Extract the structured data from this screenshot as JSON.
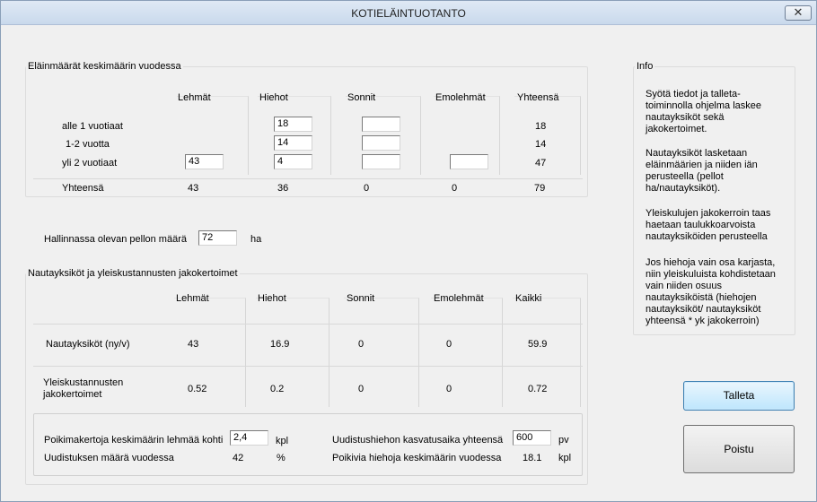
{
  "window": {
    "title": "KOTIELÄINTUOTANTO",
    "close_symbol": "✕"
  },
  "animals": {
    "legend": "Eläinmäärät keskimäärin vuodessa",
    "columns": [
      "Lehmät",
      "Hiehot",
      "Sonnit",
      "Emolehmät",
      "Yhteensä"
    ],
    "rows": [
      {
        "label": "alle 1 vuotiaat",
        "hiehot": "18",
        "sonnit": "",
        "total": "18"
      },
      {
        "label": "1-2 vuotta",
        "hiehot": "14",
        "sonnit": "",
        "total": "14"
      },
      {
        "label": "yli 2 vuotiaat",
        "lehmat": "43",
        "hiehot": "4",
        "sonnit": "",
        "emolehmat": "",
        "total": "47"
      }
    ],
    "totals": {
      "label": "Yhteensä",
      "lehmat": "43",
      "hiehot": "36",
      "sonnit": "0",
      "emolehmat": "0",
      "total": "79"
    }
  },
  "field": {
    "label": "Hallinnassa olevan pellon määrä",
    "value": "72",
    "unit": "ha"
  },
  "units": {
    "legend": "Nautayksiköt ja yleiskustannusten jakokertoimet",
    "columns": [
      "Lehmät",
      "Hiehot",
      "Sonnit",
      "Emolehmät",
      "Kaikki"
    ],
    "rows": [
      {
        "label": "Nautayksiköt  (ny/v)",
        "values": [
          "43",
          "16.9",
          "0",
          "0",
          "59.9"
        ]
      },
      {
        "label_line1": "Yleiskustannusten",
        "label_line2": "jakokertoimet",
        "values": [
          "0.52",
          "0.2",
          "0",
          "0",
          "0.72"
        ]
      }
    ]
  },
  "bottom": {
    "calvings_label": "Poikimakertoja keskimäärin lehmää kohti",
    "calvings_value": "2,4",
    "calvings_unit": "kpl",
    "renewal_label": "Uudistuksen määrä vuodessa",
    "renewal_value": "42",
    "renewal_unit": "%",
    "rearing_label": "Uudistushiehon kasvatusaika yhteensä",
    "rearing_value": "600",
    "rearing_unit": "pv",
    "heifers_label": "Poikivia hiehoja keskimäärin vuodessa",
    "heifers_value": "18.1",
    "heifers_unit": "kpl"
  },
  "info": {
    "legend": "Info",
    "paragraphs": [
      [
        "Syötä tiedot ja talleta-",
        "toiminnolla ohjelma laskee",
        "nautayksiköt sekä",
        "jakokertoimet."
      ],
      [
        "Nautayksiköt lasketaan",
        "eläinmäärien ja niiden iän",
        "perusteella (pellot",
        "ha/nautayksiköt)."
      ],
      [
        "Yleiskulujen jakokerroin taas",
        "haetaan taulukkoarvoista",
        "nautayksiköiden perusteella"
      ],
      [
        "Jos hiehoja vain osa karjasta,",
        "niin yleiskuluista kohdistetaan",
        "vain  niiden osuus",
        "nautayksiköistä (hiehojen",
        "nautayksiköt/ nautayksiköt",
        "yhteensä * yk jakokerroin)"
      ]
    ]
  },
  "buttons": {
    "save": "Talleta",
    "exit": "Poistu"
  }
}
